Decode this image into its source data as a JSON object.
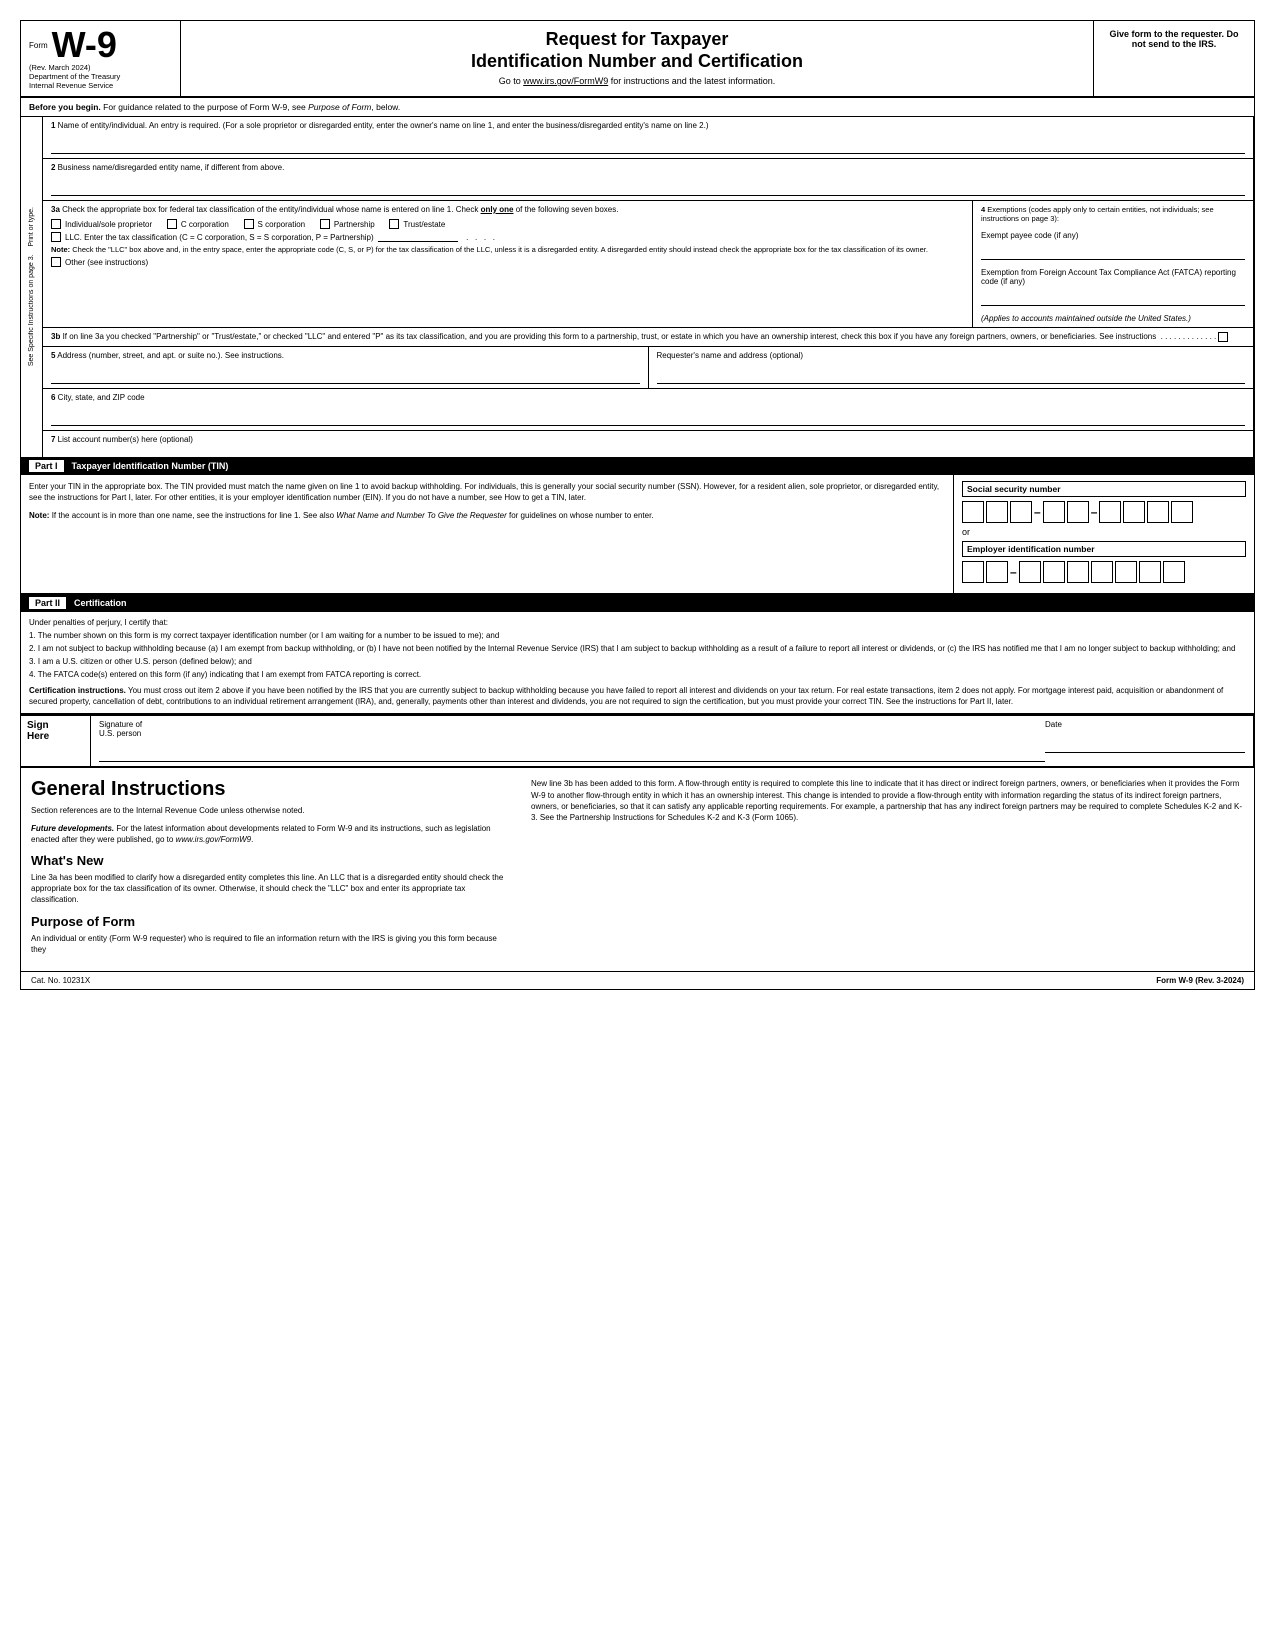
{
  "header": {
    "form_label": "Form",
    "form_name": "W-9",
    "rev_date": "(Rev. March 2024)",
    "dept": "Department of the Treasury",
    "irs": "Internal Revenue Service",
    "title_line1": "Request for Taxpayer",
    "title_line2": "Identification Number and Certification",
    "subtitle": "Go to www.irs.gov/FormW9 for instructions and the latest information.",
    "right_text": "Give form to the requester. Do not send to the IRS."
  },
  "before_begin": {
    "text": "Before you begin. For guidance related to the purpose of Form W-9, see Purpose of Form, below."
  },
  "fields": {
    "line1_label": "1  Name of entity/individual. An entry is required. (For a sole proprietor or disregarded entity, enter the owner's name on line 1, and enter the business/disregarded entity's name on line 2.)",
    "line2_label": "2  Business name/disregarded entity name, if different from above.",
    "line3a_label": "3a Check the appropriate box for federal tax classification of the entity/individual whose name is entered on line 1. Check only one of the following seven boxes.",
    "cb1_label": "Individual/sole proprietor",
    "cb2_label": "C corporation",
    "cb3_label": "S corporation",
    "cb4_label": "Partnership",
    "cb5_label": "Trust/estate",
    "cb6_label": "LLC. Enter the tax classification (C = C corporation, S = S corporation, P = Partnership)",
    "note3a": "Note: Check the \"LLC\" box above and, in the entry space, enter the appropriate code (C, S, or P) for the tax classification of the LLC, unless it is a disregarded entity. A disregarded entity should instead check the appropriate box for the tax classification of its owner.",
    "cb7_label": "Other (see instructions)",
    "exemptions_title": "4 Exemptions (codes apply only to certain entities, not individuals; see instructions on page 3):",
    "exempt_payee": "Exempt payee code (if any)",
    "fatca_label": "Exemption from Foreign Account Tax Compliance Act (FATCA) reporting code (if any)",
    "applies_note": "(Applies to accounts maintained outside the United States.)",
    "line3b_text": "3b If on line 3a you checked \"Partnership\" or \"Trust/estate,\" or checked \"LLC\" and entered \"P\" as its tax classification, and you are providing this form to a partnership, trust, or estate in which you have an ownership interest, check this box if you have any foreign partners, owners, or beneficiaries. See instructions",
    "line5_label": "5  Address (number, street, and apt. or suite no.). See instructions.",
    "line5_right": "Requester's name and address (optional)",
    "line6_label": "6  City, state, and ZIP code",
    "line7_label": "7  List account number(s) here (optional)",
    "side_label": "See Specific Instructions on page 3.  Print or type."
  },
  "part1": {
    "label": "Part I",
    "title": "Taxpayer Identification Number (TIN)",
    "description": "Enter your TIN in the appropriate box. The TIN provided must match the name given on line 1 to avoid backup withholding. For individuals, this is generally your social security number (SSN). However, for a resident alien, sole proprietor, or disregarded entity, see the instructions for Part I, later. For other entities, it is your employer identification number (EIN). If you do not have a number, see How to get a TIN, later.",
    "note": "Note: If the account is in more than one name, see the instructions for line 1. See also What Name and Number To Give the Requester for guidelines on whose number to enter.",
    "ssn_label": "Social security number",
    "or_label": "or",
    "ein_label": "Employer identification number"
  },
  "part2": {
    "label": "Part II",
    "title": "Certification",
    "intro": "Under penalties of perjury, I certify that:",
    "items": [
      "1. The number shown on this form is my correct taxpayer identification number (or I am waiting for a number to be issued to me); and",
      "2. I am not subject to backup withholding because (a) I am exempt from backup withholding, or (b) I have not been notified by the Internal Revenue Service (IRS) that I am subject to backup withholding as a result of a failure to report all interest or dividends, or (c) the IRS has notified me that I am no longer subject to backup withholding; and",
      "3. I am a U.S. citizen or other U.S. person (defined below); and",
      "4. The FATCA code(s) entered on this form (if any) indicating that I am exempt from FATCA reporting is correct."
    ],
    "cert_instructions_title": "Certification instructions.",
    "cert_instructions": "You must cross out item 2 above if you have been notified by the IRS that you are currently subject to backup withholding because you have failed to report all interest and dividends on your tax return. For real estate transactions, item 2 does not apply. For mortgage interest paid, acquisition or abandonment of secured property, cancellation of debt, contributions to an individual retirement arrangement (IRA), and, generally, payments other than interest and dividends, you are not required to sign the certification, but you must provide your correct TIN. See the instructions for Part II, later."
  },
  "sign_here": {
    "label": "Sign\nHere",
    "sig_label": "Signature of",
    "sig_sub": "U.S. person",
    "date_label": "Date"
  },
  "general": {
    "title": "General Instructions",
    "para1": "Section references are to the Internal Revenue Code unless otherwise noted.",
    "future_title": "Future developments.",
    "future_text": "For the latest information about developments related to Form W-9 and its instructions, such as legislation enacted after they were published, go to www.irs.gov/FormW9.",
    "whats_new_title": "What's New",
    "whats_new_para": "Line 3a has been modified to clarify how a disregarded entity completes this line. An LLC that is a disregarded entity should check the appropriate box for the tax classification of its owner. Otherwise, it should check the \"LLC\" box and enter its appropriate tax classification.",
    "purpose_title": "Purpose of Form",
    "purpose_para": "An individual or entity (Form W-9 requester) who is required to file an information return with the IRS is giving you this form because they"
  },
  "right_col": {
    "new_line_para": "New line 3b has been added to this form. A flow-through entity is required to complete this line to indicate that it has direct or indirect foreign partners, owners, or beneficiaries when it provides the Form W-9 to another flow-through entity in which it has an ownership interest. This change is intended to provide a flow-through entity with information regarding the status of its indirect foreign partners, owners, or beneficiaries, so that it can satisfy any applicable reporting requirements. For example, a partnership that has any indirect foreign partners may be required to complete Schedules K-2 and K-3. See the Partnership Instructions for Schedules K-2 and K-3 (Form 1065)."
  },
  "footer": {
    "cat_no": "Cat. No. 10231X",
    "form_ref": "Form W-9 (Rev. 3-2024)"
  }
}
